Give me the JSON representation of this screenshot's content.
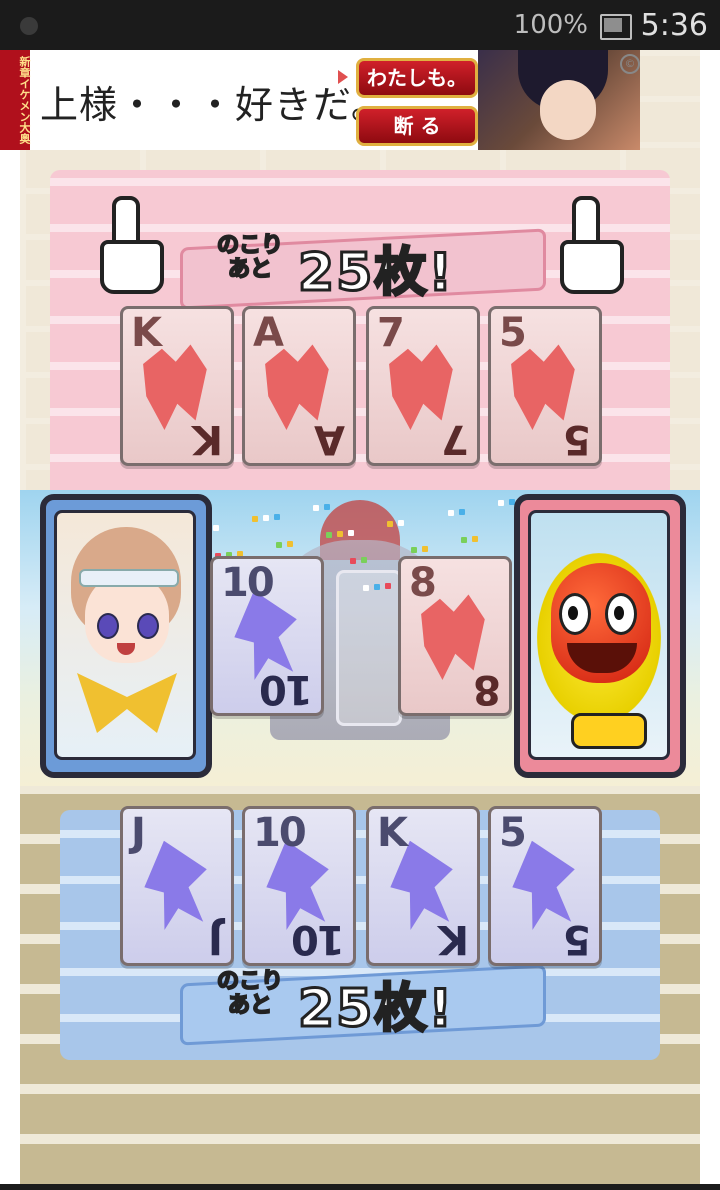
{
  "status_bar": {
    "battery": "100%",
    "time": "5:36"
  },
  "ad": {
    "vertical_text": "新章イケメン大奥",
    "headline": "上様・・・好きだ。",
    "button_accept": "わたしも。",
    "button_refuse": "断 る"
  },
  "opponent": {
    "remaining_small": "のこり\nあと",
    "remaining_big": "25枚!",
    "hand": [
      {
        "rank": "K",
        "suit": "heart"
      },
      {
        "rank": "A",
        "suit": "heart"
      },
      {
        "rank": "7",
        "suit": "heart"
      },
      {
        "rank": "5",
        "suit": "heart"
      }
    ]
  },
  "field": {
    "player_card": {
      "rank": "10",
      "suit": "spade"
    },
    "opponent_card": {
      "rank": "8",
      "suit": "heart"
    }
  },
  "player": {
    "remaining_small": "のこり\nあと",
    "remaining_big": "25枚!",
    "hand": [
      {
        "rank": "J",
        "suit": "spade"
      },
      {
        "rank": "10",
        "suit": "spade"
      },
      {
        "rank": "K",
        "suit": "spade"
      },
      {
        "rank": "5",
        "suit": "spade"
      }
    ]
  },
  "colors": {
    "heart": "#e86464",
    "spade": "#8a7ae8",
    "player_frame": "#6c9bd8",
    "enemy_frame": "#ec8a9a"
  }
}
